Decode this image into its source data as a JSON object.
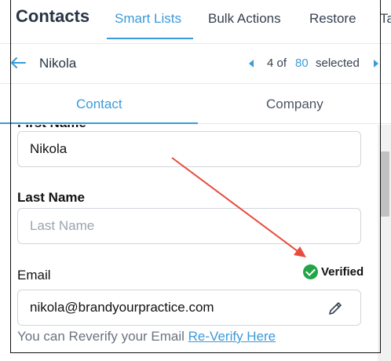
{
  "nav": {
    "app_title": "Contacts",
    "tabs": [
      {
        "label": "Smart Lists",
        "active": true
      },
      {
        "label": "Bulk Actions",
        "active": false
      },
      {
        "label": "Restore",
        "active": false
      },
      {
        "label": "Ta",
        "active": false
      }
    ]
  },
  "record": {
    "name": "Nikola",
    "position": "4 of",
    "total": "80",
    "selected_label": "selected"
  },
  "subtabs": [
    {
      "label": "Contact",
      "active": true
    },
    {
      "label": "Company",
      "active": false
    }
  ],
  "form": {
    "first_name_label": "First Name",
    "first_name_value": "Nikola",
    "last_name_label": "Last Name",
    "last_name_placeholder": "Last Name",
    "email_label": "Email",
    "email_value": "nikola@brandyourpractice.com",
    "verified_label": "Verified",
    "reverify_text": "You can Reverify your Email",
    "reverify_link": "Re-Verify Here"
  },
  "colors": {
    "accent": "#3b9bd8",
    "verified": "#22a447",
    "annotation_arrow": "#e74c3c"
  },
  "icons": {
    "back": "arrow-left-icon",
    "prev": "triangle-left-icon",
    "next": "triangle-right-icon",
    "verified": "check-circle-icon",
    "edit": "pencil-icon"
  }
}
